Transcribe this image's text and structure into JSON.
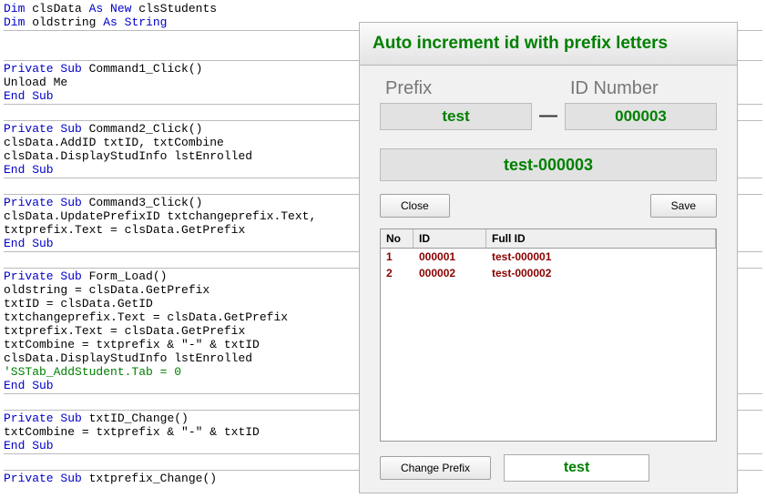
{
  "code": {
    "l1_a": "Dim",
    "l1_b": " clsData ",
    "l1_c": "As New",
    "l1_d": " clsStudents",
    "l2_a": "Dim",
    "l2_b": " oldstring ",
    "l2_c": "As String",
    "b1_a": "Private Sub",
    "b1_b": " Command1_Click()",
    "b1_c": "Unload Me",
    "b1_d": "End Sub",
    "b2_a": "Private Sub",
    "b2_b": " Command2_Click()",
    "b2_c": "clsData.AddID txtID, txtCombine",
    "b2_d": "clsData.DisplayStudInfo lstEnrolled",
    "b2_e": "End Sub",
    "b3_a": "Private Sub",
    "b3_b": " Command3_Click()",
    "b3_c": "clsData.UpdatePrefixID txtchangeprefix.Text, ",
    "b3_d": "txtprefix.Text = clsData.GetPrefix",
    "b3_e": "End Sub",
    "b4_a": "Private Sub",
    "b4_b": " Form_Load()",
    "b4_c": "oldstring = clsData.GetPrefix",
    "b4_d": "txtID = clsData.GetID",
    "b4_e": "txtchangeprefix.Text = clsData.GetPrefix",
    "b4_f": "txtprefix.Text = clsData.GetPrefix",
    "b4_g": "txtCombine = txtprefix & \"-\" & txtID",
    "b4_h": "clsData.DisplayStudInfo lstEnrolled",
    "b4_i": "'SSTab_AddStudent.Tab = 0",
    "b4_j": "End Sub",
    "b5_a": "Private Sub",
    "b5_b": " txtID_Change()",
    "b5_c": "txtCombine = txtprefix & \"-\" & txtID",
    "b5_d": "End Sub",
    "b6_a": "Private Sub",
    "b6_b": " txtprefix_Change()"
  },
  "dialog": {
    "title": "Auto increment id with prefix letters",
    "prefix_label": "Prefix",
    "id_label": "ID Number",
    "prefix_value": "test",
    "id_value": "000003",
    "dash": "—",
    "combined": "test-000003",
    "close_btn": "Close",
    "save_btn": "Save",
    "change_prefix_btn": "Change Prefix",
    "prefix_input_value": "test",
    "grid": {
      "col_no": "No",
      "col_id": "ID",
      "col_full": "Full ID",
      "rows": [
        {
          "no": "1",
          "id": "000001",
          "full": "test-000001"
        },
        {
          "no": "2",
          "id": "000002",
          "full": "test-000002"
        }
      ]
    }
  }
}
